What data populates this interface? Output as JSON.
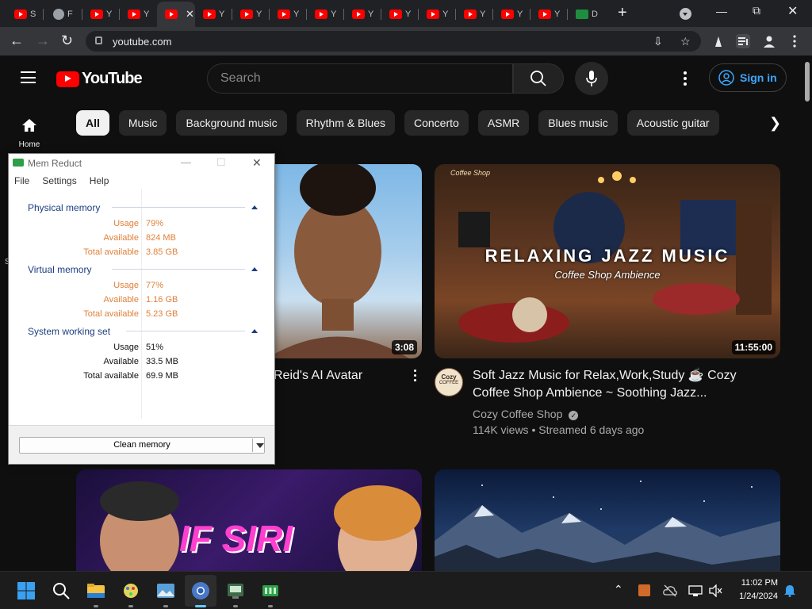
{
  "browser": {
    "tabs": [
      {
        "label": "S",
        "favicon": "youtube-icon"
      },
      {
        "label": "F",
        "favicon": "globe-icon"
      },
      {
        "label": "Y",
        "favicon": "youtube-icon"
      },
      {
        "label": "Y",
        "favicon": "youtube-icon"
      },
      {
        "label": "",
        "favicon": "youtube-icon",
        "active": true
      },
      {
        "label": "Y",
        "favicon": "youtube-icon"
      },
      {
        "label": "Y",
        "favicon": "youtube-icon"
      },
      {
        "label": "Y",
        "favicon": "youtube-icon"
      },
      {
        "label": "Y",
        "favicon": "youtube-icon"
      },
      {
        "label": "Y",
        "favicon": "youtube-icon"
      },
      {
        "label": "Y",
        "favicon": "youtube-icon"
      },
      {
        "label": "Y",
        "favicon": "youtube-icon"
      },
      {
        "label": "Y",
        "favicon": "youtube-icon"
      },
      {
        "label": "Y",
        "favicon": "youtube-icon"
      },
      {
        "label": "Y",
        "favicon": "youtube-icon"
      },
      {
        "label": "D",
        "favicon": "memreduct-icon"
      }
    ],
    "tab_close_glyph": "✕",
    "new_tab_glyph": "+",
    "url": "youtube.com"
  },
  "youtube": {
    "search_placeholder": "Search",
    "signin_label": "Sign in",
    "home_label": "Home",
    "chips": [
      "All",
      "Music",
      "Background music",
      "Rhythm & Blues",
      "Concerto",
      "ASMR",
      "Blues music",
      "Acoustic guitar"
    ],
    "videos": {
      "v1": {
        "title": "Reid's AI Avatar",
        "duration": "3:08"
      },
      "v2": {
        "title_line1": "Soft Jazz Music for Relax,Work,Study ☕ Cozy",
        "title_line2": "Coffee Shop Ambience ~ Soothing Jazz...",
        "channel": "Cozy Coffee Shop",
        "stats": "114K views • Streamed 6 days ago",
        "duration": "11:55:00",
        "thumb_heading": "RELAXING JAZZ MUSIC",
        "thumb_subheading": "Coffee Shop Ambience",
        "thumb_sign": "Coffee Shop",
        "avatar_text_1": "Cozy",
        "avatar_text_2": "COFFEE"
      },
      "v3": {
        "thumb_text": "IF SIRI"
      }
    },
    "sidebar_letter": "S"
  },
  "memreduct": {
    "title": "Mem Reduct",
    "menu": [
      "File",
      "Settings",
      "Help"
    ],
    "sections": [
      {
        "name": "Physical memory",
        "rows": [
          {
            "key": "Usage",
            "value": "79%"
          },
          {
            "key": "Available",
            "value": "824 MB"
          },
          {
            "key": "Total available",
            "value": "3.85 GB"
          }
        ]
      },
      {
        "name": "Virtual memory",
        "rows": [
          {
            "key": "Usage",
            "value": "77%"
          },
          {
            "key": "Available",
            "value": "1.16 GB"
          },
          {
            "key": "Total available",
            "value": "5.23 GB"
          }
        ]
      },
      {
        "name": "System working set",
        "rows": [
          {
            "key": "Usage",
            "value": "51%"
          },
          {
            "key": "Available",
            "value": "33.5 MB"
          },
          {
            "key": "Total available",
            "value": "69.9 MB"
          }
        ]
      }
    ],
    "clean_button_label": "Clean memory"
  },
  "taskbar": {
    "time": "11:02 PM",
    "date": "1/24/2024"
  },
  "colors": {
    "yt_red": "#ff0000",
    "link_blue": "#3ea6ff",
    "memreduct_orange": "#e0803a",
    "memreduct_section_blue": "#1c3d80",
    "taskbar_active": "#60cdff"
  }
}
